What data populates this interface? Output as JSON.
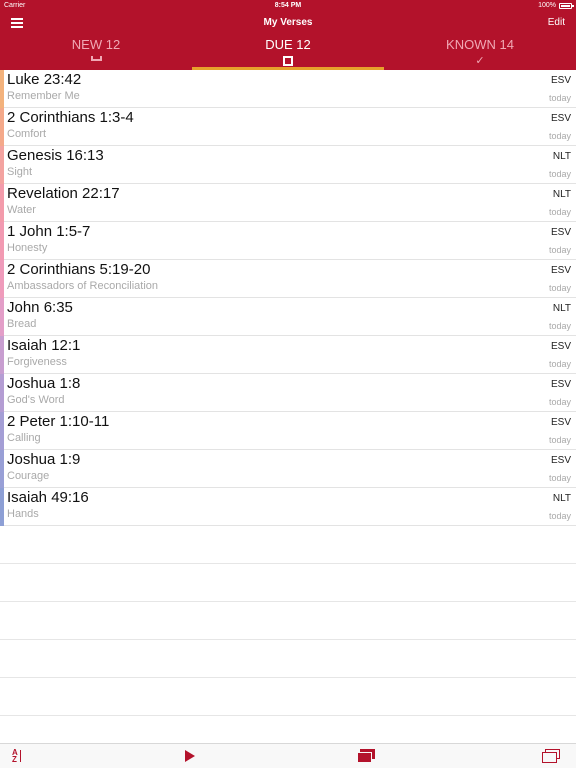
{
  "status_bar": {
    "carrier": "Carrier",
    "time": "8:54 PM",
    "battery": "100%"
  },
  "nav": {
    "title": "My Verses",
    "edit_label": "Edit"
  },
  "tabs": [
    {
      "label": "NEW 12",
      "icon": "tray-icon",
      "active": false
    },
    {
      "label": "DUE 12",
      "icon": "square-icon",
      "active": true
    },
    {
      "label": "KNOWN 14",
      "icon": "checkmark-icon",
      "active": false
    }
  ],
  "verses": [
    {
      "ref": "Luke 23:42",
      "topic": "Remember Me",
      "version": "ESV",
      "due": "today",
      "color": "#f3b27c"
    },
    {
      "ref": "2 Corinthians 1:3-4",
      "topic": "Comfort",
      "version": "ESV",
      "due": "today",
      "color": "#f4a98a"
    },
    {
      "ref": "Genesis 16:13",
      "topic": "Sight",
      "version": "NLT",
      "due": "today",
      "color": "#f3a3a0"
    },
    {
      "ref": "Revelation 22:17",
      "topic": "Water",
      "version": "NLT",
      "due": "today",
      "color": "#f39bab"
    },
    {
      "ref": "1 John 1:5-7",
      "topic": "Honesty",
      "version": "ESV",
      "due": "today",
      "color": "#f29ab2"
    },
    {
      "ref": "2 Corinthians 5:19-20",
      "topic": "Ambassadors of Reconciliation",
      "version": "ESV",
      "due": "today",
      "color": "#ef9bbb"
    },
    {
      "ref": "John 6:35",
      "topic": "Bread",
      "version": "NLT",
      "due": "today",
      "color": "#e39ec8"
    },
    {
      "ref": "Isaiah 12:1",
      "topic": "Forgiveness",
      "version": "ESV",
      "due": "today",
      "color": "#c89ed0"
    },
    {
      "ref": "Joshua 1:8",
      "topic": "God's Word",
      "version": "ESV",
      "due": "today",
      "color": "#b49dd3"
    },
    {
      "ref": "2 Peter 1:10-11",
      "topic": "Calling",
      "version": "ESV",
      "due": "today",
      "color": "#a49ed5"
    },
    {
      "ref": "Joshua 1:9",
      "topic": "Courage",
      "version": "ESV",
      "due": "today",
      "color": "#989fd6"
    },
    {
      "ref": "Isaiah 49:16",
      "topic": "Hands",
      "version": "NLT",
      "due": "today",
      "color": "#8d9fd5"
    }
  ],
  "toolbar": {
    "sort_label": "A Z",
    "icons": [
      "sort-az-icon",
      "play-icon",
      "cards-icon",
      "stack-icon"
    ]
  },
  "colors": {
    "accent": "#b3122b",
    "tab_indicator": "#e7a12c"
  }
}
